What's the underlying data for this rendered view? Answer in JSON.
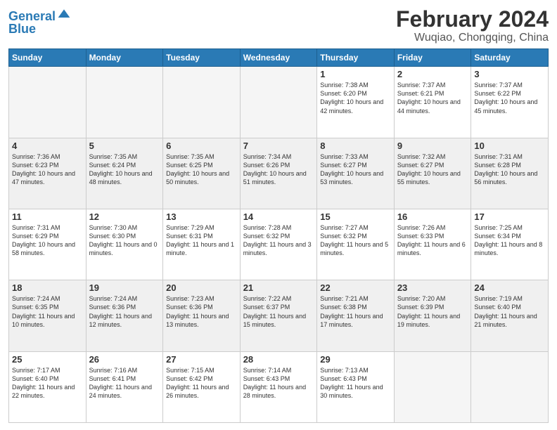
{
  "header": {
    "logo_line1": "General",
    "logo_line2": "Blue",
    "title": "February 2024",
    "subtitle": "Wuqiao, Chongqing, China"
  },
  "weekdays": [
    "Sunday",
    "Monday",
    "Tuesday",
    "Wednesday",
    "Thursday",
    "Friday",
    "Saturday"
  ],
  "rows": [
    [
      {
        "day": "",
        "empty": true
      },
      {
        "day": "",
        "empty": true
      },
      {
        "day": "",
        "empty": true
      },
      {
        "day": "",
        "empty": true
      },
      {
        "day": "1",
        "info": "Sunrise: 7:38 AM\nSunset: 6:20 PM\nDaylight: 10 hours\nand 42 minutes."
      },
      {
        "day": "2",
        "info": "Sunrise: 7:37 AM\nSunset: 6:21 PM\nDaylight: 10 hours\nand 44 minutes."
      },
      {
        "day": "3",
        "info": "Sunrise: 7:37 AM\nSunset: 6:22 PM\nDaylight: 10 hours\nand 45 minutes."
      }
    ],
    [
      {
        "day": "4",
        "info": "Sunrise: 7:36 AM\nSunset: 6:23 PM\nDaylight: 10 hours\nand 47 minutes."
      },
      {
        "day": "5",
        "info": "Sunrise: 7:35 AM\nSunset: 6:24 PM\nDaylight: 10 hours\nand 48 minutes."
      },
      {
        "day": "6",
        "info": "Sunrise: 7:35 AM\nSunset: 6:25 PM\nDaylight: 10 hours\nand 50 minutes."
      },
      {
        "day": "7",
        "info": "Sunrise: 7:34 AM\nSunset: 6:26 PM\nDaylight: 10 hours\nand 51 minutes."
      },
      {
        "day": "8",
        "info": "Sunrise: 7:33 AM\nSunset: 6:27 PM\nDaylight: 10 hours\nand 53 minutes."
      },
      {
        "day": "9",
        "info": "Sunrise: 7:32 AM\nSunset: 6:27 PM\nDaylight: 10 hours\nand 55 minutes."
      },
      {
        "day": "10",
        "info": "Sunrise: 7:31 AM\nSunset: 6:28 PM\nDaylight: 10 hours\nand 56 minutes."
      }
    ],
    [
      {
        "day": "11",
        "info": "Sunrise: 7:31 AM\nSunset: 6:29 PM\nDaylight: 10 hours\nand 58 minutes."
      },
      {
        "day": "12",
        "info": "Sunrise: 7:30 AM\nSunset: 6:30 PM\nDaylight: 11 hours\nand 0 minutes."
      },
      {
        "day": "13",
        "info": "Sunrise: 7:29 AM\nSunset: 6:31 PM\nDaylight: 11 hours\nand 1 minute."
      },
      {
        "day": "14",
        "info": "Sunrise: 7:28 AM\nSunset: 6:32 PM\nDaylight: 11 hours\nand 3 minutes."
      },
      {
        "day": "15",
        "info": "Sunrise: 7:27 AM\nSunset: 6:32 PM\nDaylight: 11 hours\nand 5 minutes."
      },
      {
        "day": "16",
        "info": "Sunrise: 7:26 AM\nSunset: 6:33 PM\nDaylight: 11 hours\nand 6 minutes."
      },
      {
        "day": "17",
        "info": "Sunrise: 7:25 AM\nSunset: 6:34 PM\nDaylight: 11 hours\nand 8 minutes."
      }
    ],
    [
      {
        "day": "18",
        "info": "Sunrise: 7:24 AM\nSunset: 6:35 PM\nDaylight: 11 hours\nand 10 minutes."
      },
      {
        "day": "19",
        "info": "Sunrise: 7:24 AM\nSunset: 6:36 PM\nDaylight: 11 hours\nand 12 minutes."
      },
      {
        "day": "20",
        "info": "Sunrise: 7:23 AM\nSunset: 6:36 PM\nDaylight: 11 hours\nand 13 minutes."
      },
      {
        "day": "21",
        "info": "Sunrise: 7:22 AM\nSunset: 6:37 PM\nDaylight: 11 hours\nand 15 minutes."
      },
      {
        "day": "22",
        "info": "Sunrise: 7:21 AM\nSunset: 6:38 PM\nDaylight: 11 hours\nand 17 minutes."
      },
      {
        "day": "23",
        "info": "Sunrise: 7:20 AM\nSunset: 6:39 PM\nDaylight: 11 hours\nand 19 minutes."
      },
      {
        "day": "24",
        "info": "Sunrise: 7:19 AM\nSunset: 6:40 PM\nDaylight: 11 hours\nand 21 minutes."
      }
    ],
    [
      {
        "day": "25",
        "info": "Sunrise: 7:17 AM\nSunset: 6:40 PM\nDaylight: 11 hours\nand 22 minutes."
      },
      {
        "day": "26",
        "info": "Sunrise: 7:16 AM\nSunset: 6:41 PM\nDaylight: 11 hours\nand 24 minutes."
      },
      {
        "day": "27",
        "info": "Sunrise: 7:15 AM\nSunset: 6:42 PM\nDaylight: 11 hours\nand 26 minutes."
      },
      {
        "day": "28",
        "info": "Sunrise: 7:14 AM\nSunset: 6:43 PM\nDaylight: 11 hours\nand 28 minutes."
      },
      {
        "day": "29",
        "info": "Sunrise: 7:13 AM\nSunset: 6:43 PM\nDaylight: 11 hours\nand 30 minutes."
      },
      {
        "day": "",
        "empty": true
      },
      {
        "day": "",
        "empty": true
      }
    ]
  ]
}
